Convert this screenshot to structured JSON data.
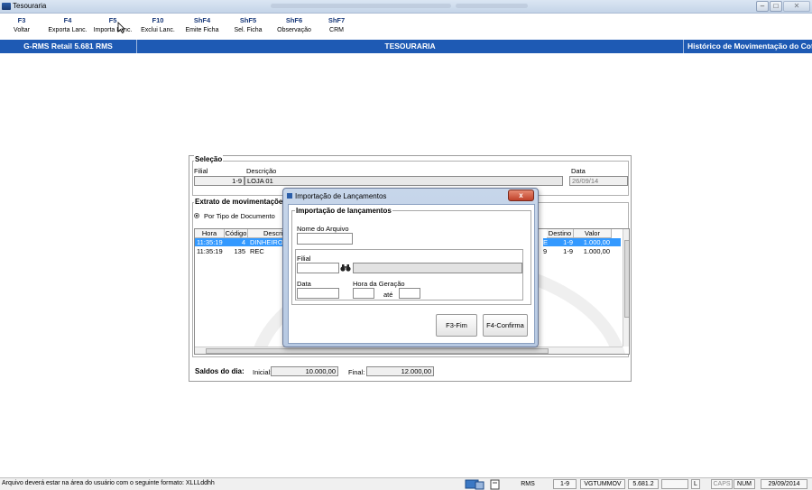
{
  "window": {
    "title": "Tesouraria",
    "minimize": "–",
    "maximize": "□",
    "close": "✕"
  },
  "fkeys": [
    {
      "key": "F3",
      "label": "Voltar"
    },
    {
      "key": "F4",
      "label": "Exporta Lanc."
    },
    {
      "key": "F5",
      "label": "Importa Lanc."
    },
    {
      "key": "F10",
      "label": "Exclui Lanc."
    },
    {
      "key": "ShF4",
      "label": "Emite Ficha"
    },
    {
      "key": "ShF5",
      "label": "Sel. Ficha"
    },
    {
      "key": "ShF6",
      "label": "Observação"
    },
    {
      "key": "ShF7",
      "label": "CRM"
    }
  ],
  "header": {
    "system": "G-RMS Retail 5.681 RMS",
    "module": "TESOURARIA",
    "screen": "Histórico de Movimentação do Cofre"
  },
  "selecao": {
    "title": "Seleção",
    "filial_label": "Filial",
    "descricao_label": "Descrição",
    "data_label": "Data",
    "filial_value": "1-9",
    "descricao_value": "LOJA 01",
    "data_value": "26/09/14"
  },
  "extrato": {
    "title": "Extrato de movimentações",
    "radio_label": "Por Tipo de Documento",
    "columns": [
      "Hora",
      "Código",
      "Descriç",
      "Destino",
      "Valor"
    ],
    "rows": [
      {
        "hora": "11:35:19",
        "codigo": "4",
        "descricao": "DINHEIRO",
        "origem": "E",
        "destino": "1-9",
        "valor": "1.000,00"
      },
      {
        "hora": "11:35:19",
        "codigo": "135",
        "descricao": "REC",
        "origem": "9",
        "destino": "1-9",
        "valor": "1.000,00"
      }
    ]
  },
  "saldos": {
    "label": "Saldos do dia:",
    "inicial_label": "Inicial:",
    "inicial_value": "10.000,00",
    "final_label": "Final:",
    "final_value": "12.000,00"
  },
  "dialog": {
    "title": "Importação de Lançamentos",
    "group_title": "Importação de lançamentos",
    "nome_arquivo_label": "Nome do Arquivo",
    "filial_label": "Filial",
    "data_label": "Data",
    "hora_label": "Hora da Geração",
    "ate_label": "até",
    "btn_fim": "F3-Fim",
    "btn_confirma": "F4-Confirma",
    "close": "x"
  },
  "statusbar": {
    "message": "Arquivo deverá estar na área do usuário com o seguinte formato: XLLLddhh",
    "cells": [
      "RMS",
      "1-9",
      "VGTUMMOV",
      "5.681.2",
      "",
      "L",
      "CAPS",
      "NUM",
      "29/09/2014"
    ]
  }
}
